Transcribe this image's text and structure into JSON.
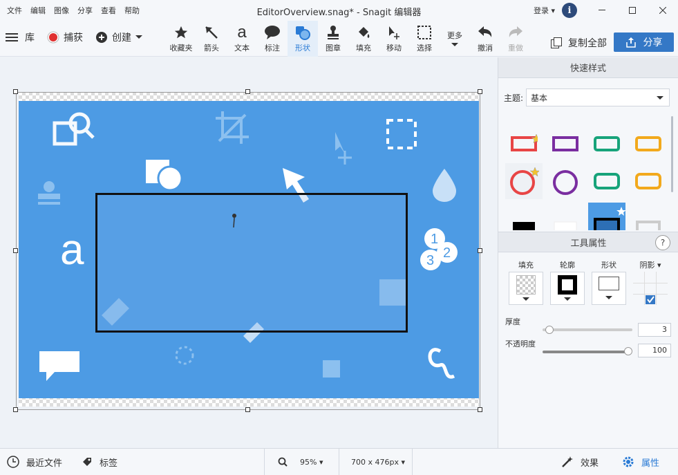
{
  "menu": [
    "文件",
    "编辑",
    "图像",
    "分享",
    "查看",
    "帮助"
  ],
  "window": {
    "title": "EditorOverview.snag* - Snagit 编辑器",
    "login": "登录 ▾",
    "info": "i"
  },
  "toolbar": {
    "library": "库",
    "capture": "捕获",
    "create": "创建",
    "tools": [
      {
        "label": "收藏夹",
        "icon": "star-icon"
      },
      {
        "label": "箭头",
        "icon": "arrow-icon"
      },
      {
        "label": "文本",
        "icon": "text-icon"
      },
      {
        "label": "标注",
        "icon": "callout-icon"
      },
      {
        "label": "形状",
        "icon": "shape-icon"
      },
      {
        "label": "图章",
        "icon": "stamp-icon"
      },
      {
        "label": "填充",
        "icon": "fill-icon"
      },
      {
        "label": "移动",
        "icon": "move-icon"
      },
      {
        "label": "选择",
        "icon": "select-icon"
      },
      {
        "label": "更多",
        "icon": "more-icon"
      },
      {
        "label": "撤消",
        "icon": "undo-icon"
      },
      {
        "label": "重做",
        "icon": "redo-icon"
      }
    ],
    "copy_all": "复制全部",
    "share": "分享"
  },
  "quick_styles": {
    "header": "快速样式",
    "theme_label": "主题:",
    "theme_value": "基本"
  },
  "tool_props": {
    "header": "工具属性",
    "help": "?",
    "fill": "填充",
    "outline": "轮廓",
    "shape": "形状",
    "shadow": "阴影 ▾",
    "thickness_label": "厚度",
    "thickness_value": "3",
    "opacity_label": "不透明度",
    "opacity_value": "100"
  },
  "status": {
    "recent": "最近文件",
    "tags": "标签",
    "zoom": "95% ▾",
    "size": "700 x 476px ▾",
    "effects": "效果",
    "properties": "属性"
  },
  "colors": {
    "accent": "#3478c6",
    "canvas_blue": "#4d9be4"
  }
}
